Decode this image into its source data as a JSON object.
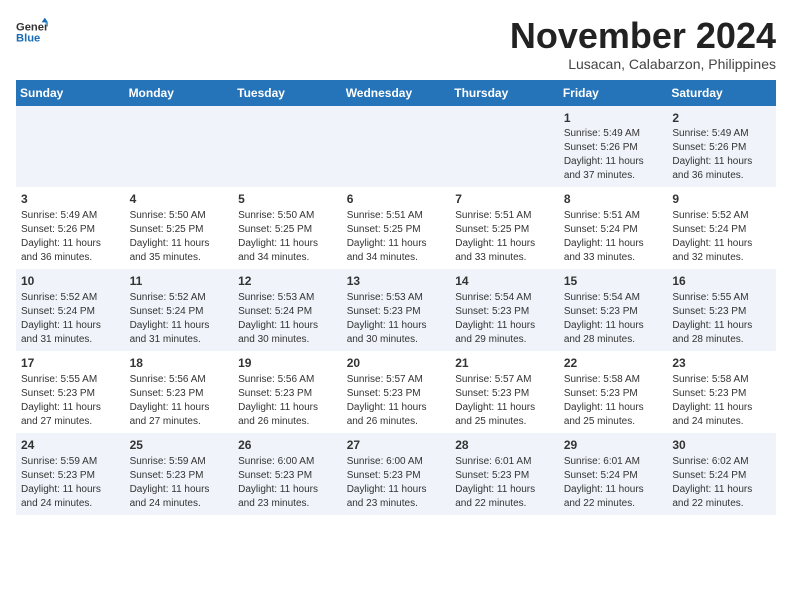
{
  "header": {
    "logo_general": "General",
    "logo_blue": "Blue",
    "month": "November 2024",
    "location": "Lusacan, Calabarzon, Philippines"
  },
  "weekdays": [
    "Sunday",
    "Monday",
    "Tuesday",
    "Wednesday",
    "Thursday",
    "Friday",
    "Saturday"
  ],
  "rows": [
    [
      {
        "day": "",
        "info": ""
      },
      {
        "day": "",
        "info": ""
      },
      {
        "day": "",
        "info": ""
      },
      {
        "day": "",
        "info": ""
      },
      {
        "day": "",
        "info": ""
      },
      {
        "day": "1",
        "info": "Sunrise: 5:49 AM\nSunset: 5:26 PM\nDaylight: 11 hours\nand 37 minutes."
      },
      {
        "day": "2",
        "info": "Sunrise: 5:49 AM\nSunset: 5:26 PM\nDaylight: 11 hours\nand 36 minutes."
      }
    ],
    [
      {
        "day": "3",
        "info": "Sunrise: 5:49 AM\nSunset: 5:26 PM\nDaylight: 11 hours\nand 36 minutes."
      },
      {
        "day": "4",
        "info": "Sunrise: 5:50 AM\nSunset: 5:25 PM\nDaylight: 11 hours\nand 35 minutes."
      },
      {
        "day": "5",
        "info": "Sunrise: 5:50 AM\nSunset: 5:25 PM\nDaylight: 11 hours\nand 34 minutes."
      },
      {
        "day": "6",
        "info": "Sunrise: 5:51 AM\nSunset: 5:25 PM\nDaylight: 11 hours\nand 34 minutes."
      },
      {
        "day": "7",
        "info": "Sunrise: 5:51 AM\nSunset: 5:25 PM\nDaylight: 11 hours\nand 33 minutes."
      },
      {
        "day": "8",
        "info": "Sunrise: 5:51 AM\nSunset: 5:24 PM\nDaylight: 11 hours\nand 33 minutes."
      },
      {
        "day": "9",
        "info": "Sunrise: 5:52 AM\nSunset: 5:24 PM\nDaylight: 11 hours\nand 32 minutes."
      }
    ],
    [
      {
        "day": "10",
        "info": "Sunrise: 5:52 AM\nSunset: 5:24 PM\nDaylight: 11 hours\nand 31 minutes."
      },
      {
        "day": "11",
        "info": "Sunrise: 5:52 AM\nSunset: 5:24 PM\nDaylight: 11 hours\nand 31 minutes."
      },
      {
        "day": "12",
        "info": "Sunrise: 5:53 AM\nSunset: 5:24 PM\nDaylight: 11 hours\nand 30 minutes."
      },
      {
        "day": "13",
        "info": "Sunrise: 5:53 AM\nSunset: 5:23 PM\nDaylight: 11 hours\nand 30 minutes."
      },
      {
        "day": "14",
        "info": "Sunrise: 5:54 AM\nSunset: 5:23 PM\nDaylight: 11 hours\nand 29 minutes."
      },
      {
        "day": "15",
        "info": "Sunrise: 5:54 AM\nSunset: 5:23 PM\nDaylight: 11 hours\nand 28 minutes."
      },
      {
        "day": "16",
        "info": "Sunrise: 5:55 AM\nSunset: 5:23 PM\nDaylight: 11 hours\nand 28 minutes."
      }
    ],
    [
      {
        "day": "17",
        "info": "Sunrise: 5:55 AM\nSunset: 5:23 PM\nDaylight: 11 hours\nand 27 minutes."
      },
      {
        "day": "18",
        "info": "Sunrise: 5:56 AM\nSunset: 5:23 PM\nDaylight: 11 hours\nand 27 minutes."
      },
      {
        "day": "19",
        "info": "Sunrise: 5:56 AM\nSunset: 5:23 PM\nDaylight: 11 hours\nand 26 minutes."
      },
      {
        "day": "20",
        "info": "Sunrise: 5:57 AM\nSunset: 5:23 PM\nDaylight: 11 hours\nand 26 minutes."
      },
      {
        "day": "21",
        "info": "Sunrise: 5:57 AM\nSunset: 5:23 PM\nDaylight: 11 hours\nand 25 minutes."
      },
      {
        "day": "22",
        "info": "Sunrise: 5:58 AM\nSunset: 5:23 PM\nDaylight: 11 hours\nand 25 minutes."
      },
      {
        "day": "23",
        "info": "Sunrise: 5:58 AM\nSunset: 5:23 PM\nDaylight: 11 hours\nand 24 minutes."
      }
    ],
    [
      {
        "day": "24",
        "info": "Sunrise: 5:59 AM\nSunset: 5:23 PM\nDaylight: 11 hours\nand 24 minutes."
      },
      {
        "day": "25",
        "info": "Sunrise: 5:59 AM\nSunset: 5:23 PM\nDaylight: 11 hours\nand 24 minutes."
      },
      {
        "day": "26",
        "info": "Sunrise: 6:00 AM\nSunset: 5:23 PM\nDaylight: 11 hours\nand 23 minutes."
      },
      {
        "day": "27",
        "info": "Sunrise: 6:00 AM\nSunset: 5:23 PM\nDaylight: 11 hours\nand 23 minutes."
      },
      {
        "day": "28",
        "info": "Sunrise: 6:01 AM\nSunset: 5:23 PM\nDaylight: 11 hours\nand 22 minutes."
      },
      {
        "day": "29",
        "info": "Sunrise: 6:01 AM\nSunset: 5:24 PM\nDaylight: 11 hours\nand 22 minutes."
      },
      {
        "day": "30",
        "info": "Sunrise: 6:02 AM\nSunset: 5:24 PM\nDaylight: 11 hours\nand 22 minutes."
      }
    ]
  ]
}
